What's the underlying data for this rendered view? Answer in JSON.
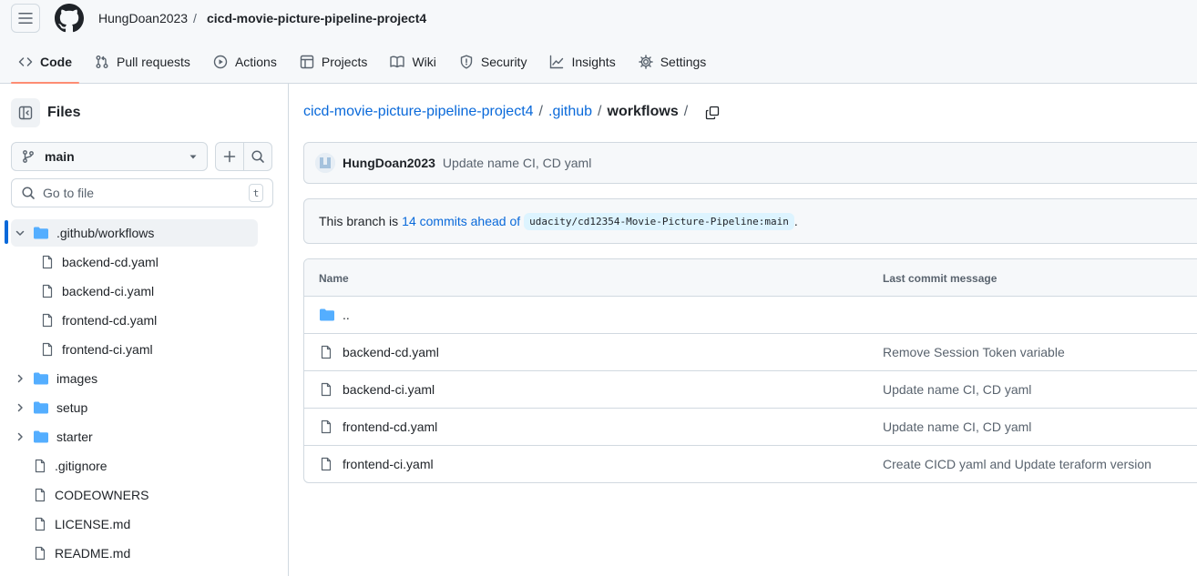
{
  "header": {
    "owner": "HungDoan2023",
    "separator": "/",
    "repo": "cicd-movie-picture-pipeline-project4"
  },
  "repo_nav": {
    "tabs": [
      {
        "label": "Code",
        "icon": "code-icon",
        "active": true
      },
      {
        "label": "Pull requests",
        "icon": "git-pull-request-icon"
      },
      {
        "label": "Actions",
        "icon": "play-icon"
      },
      {
        "label": "Projects",
        "icon": "table-icon"
      },
      {
        "label": "Wiki",
        "icon": "book-icon"
      },
      {
        "label": "Security",
        "icon": "shield-icon"
      },
      {
        "label": "Insights",
        "icon": "graph-icon"
      },
      {
        "label": "Settings",
        "icon": "gear-icon"
      }
    ]
  },
  "sidebar": {
    "title": "Files",
    "branch": "main",
    "goto_placeholder": "Go to file",
    "goto_shortcut": "t",
    "tree": [
      {
        "label": ".github/workflows",
        "type": "folder",
        "expanded": true,
        "selected": true
      },
      {
        "label": "backend-cd.yaml",
        "type": "file",
        "depth": 1
      },
      {
        "label": "backend-ci.yaml",
        "type": "file",
        "depth": 1
      },
      {
        "label": "frontend-cd.yaml",
        "type": "file",
        "depth": 1
      },
      {
        "label": "frontend-ci.yaml",
        "type": "file",
        "depth": 1
      },
      {
        "label": "images",
        "type": "folder",
        "expanded": false
      },
      {
        "label": "setup",
        "type": "folder",
        "expanded": false
      },
      {
        "label": "starter",
        "type": "folder",
        "expanded": false
      },
      {
        "label": ".gitignore",
        "type": "file"
      },
      {
        "label": "CODEOWNERS",
        "type": "file"
      },
      {
        "label": "LICENSE.md",
        "type": "file"
      },
      {
        "label": "README.md",
        "type": "file"
      }
    ]
  },
  "breadcrumbs": {
    "root": "cicd-movie-picture-pipeline-project4",
    "parent": ".github",
    "current": "workflows",
    "sep": "/"
  },
  "latest_commit": {
    "author": "HungDoan2023",
    "message": "Update name CI, CD yaml"
  },
  "branch_status": {
    "prefix": "This branch is",
    "link": "14 commits ahead of",
    "upstream": "udacity/cd12354-Movie-Picture-Pipeline:main",
    "suffix": "."
  },
  "file_table": {
    "col_name": "Name",
    "col_message": "Last commit message",
    "rows": [
      {
        "name": "..",
        "type": "parent",
        "message": ""
      },
      {
        "name": "backend-cd.yaml",
        "type": "file",
        "message": "Remove Session Token variable"
      },
      {
        "name": "backend-ci.yaml",
        "type": "file",
        "message": "Update name CI, CD yaml"
      },
      {
        "name": "frontend-cd.yaml",
        "type": "file",
        "message": "Update name CI, CD yaml"
      },
      {
        "name": "frontend-ci.yaml",
        "type": "file",
        "message": "Create CICD yaml and Update teraform version"
      }
    ]
  },
  "colors": {
    "link": "#0969da",
    "folder": "#54aeff",
    "active_tab_underline": "#fd8c73",
    "border": "#d1d9e0",
    "muted_text": "#59636e"
  }
}
